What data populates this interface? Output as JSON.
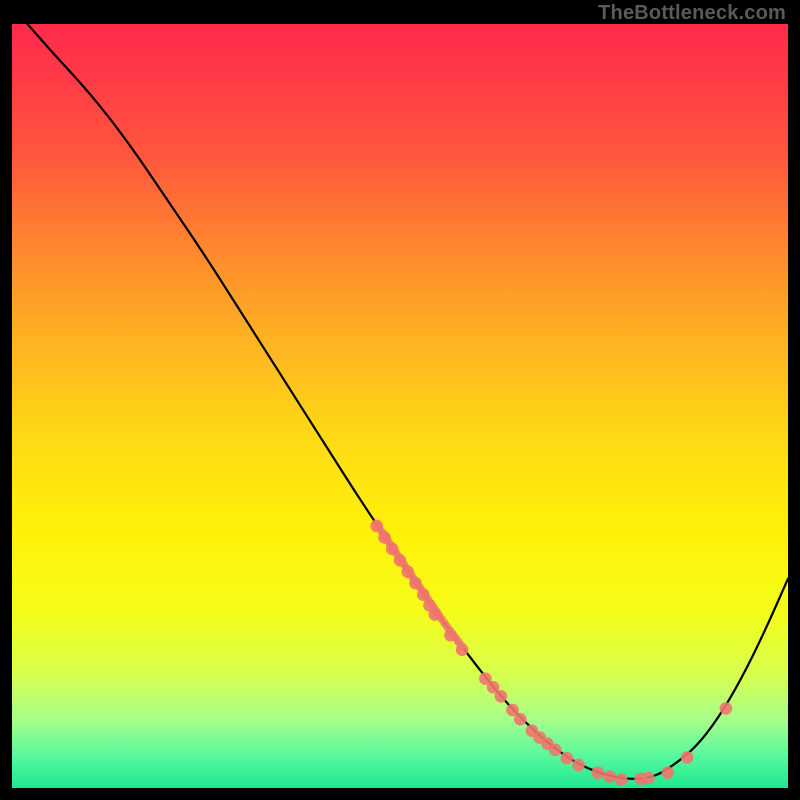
{
  "attribution": "TheBottleneck.com",
  "colors": {
    "gradient_top": "#ff2b4b",
    "gradient_bottom": "#1ee88f",
    "curve_stroke": "#000000",
    "point_fill": "#f0766d",
    "point_stroke": "#f0766d"
  },
  "chart_data": {
    "type": "line",
    "title": "",
    "xlabel": "",
    "ylabel": "",
    "xlim": [
      0,
      100
    ],
    "ylim": [
      0,
      100
    ],
    "grid": false,
    "curve": [
      {
        "x": 2,
        "y": 100
      },
      {
        "x": 5,
        "y": 96.5
      },
      {
        "x": 10,
        "y": 91
      },
      {
        "x": 15,
        "y": 84.5
      },
      {
        "x": 20,
        "y": 77
      },
      {
        "x": 25,
        "y": 69.5
      },
      {
        "x": 30,
        "y": 61.5
      },
      {
        "x": 35,
        "y": 53.5
      },
      {
        "x": 40,
        "y": 45.5
      },
      {
        "x": 45,
        "y": 37.5
      },
      {
        "x": 50,
        "y": 30
      },
      {
        "x": 53,
        "y": 25.6
      },
      {
        "x": 56,
        "y": 21.2
      },
      {
        "x": 60,
        "y": 15.8
      },
      {
        "x": 64,
        "y": 10.8
      },
      {
        "x": 68,
        "y": 6.8
      },
      {
        "x": 71,
        "y": 4.4
      },
      {
        "x": 74,
        "y": 2.6
      },
      {
        "x": 77,
        "y": 1.6
      },
      {
        "x": 79,
        "y": 1.2
      },
      {
        "x": 81,
        "y": 1.2
      },
      {
        "x": 83,
        "y": 1.6
      },
      {
        "x": 85,
        "y": 2.8
      },
      {
        "x": 88,
        "y": 5.2
      },
      {
        "x": 91,
        "y": 9.1
      },
      {
        "x": 94,
        "y": 14.3
      },
      {
        "x": 97,
        "y": 20.5
      },
      {
        "x": 100,
        "y": 27.4
      }
    ],
    "points_cluster_coarse": [
      {
        "x": 47,
        "y": 34.3
      },
      {
        "x": 48,
        "y": 32.8
      },
      {
        "x": 49,
        "y": 31.3
      },
      {
        "x": 50,
        "y": 29.8
      },
      {
        "x": 51,
        "y": 28.3
      },
      {
        "x": 52,
        "y": 26.8
      },
      {
        "x": 53,
        "y": 25.3
      },
      {
        "x": 53.8,
        "y": 23.9
      },
      {
        "x": 54.5,
        "y": 22.7
      },
      {
        "x": 56.5,
        "y": 20.0
      },
      {
        "x": 58,
        "y": 18.1
      },
      {
        "x": 61,
        "y": 14.3
      },
      {
        "x": 62,
        "y": 13.2
      },
      {
        "x": 63,
        "y": 12.0
      },
      {
        "x": 64.5,
        "y": 10.2
      },
      {
        "x": 65.5,
        "y": 9.0
      },
      {
        "x": 67,
        "y": 7.5
      },
      {
        "x": 68,
        "y": 6.6
      },
      {
        "x": 69,
        "y": 5.8
      },
      {
        "x": 70,
        "y": 5.0
      },
      {
        "x": 71.5,
        "y": 3.9
      },
      {
        "x": 73,
        "y": 3.0
      },
      {
        "x": 75.5,
        "y": 2.0
      },
      {
        "x": 77,
        "y": 1.5
      },
      {
        "x": 78.5,
        "y": 1.1
      },
      {
        "x": 81,
        "y": 1.2
      },
      {
        "x": 82,
        "y": 1.3
      },
      {
        "x": 84.5,
        "y": 2.0
      },
      {
        "x": 87,
        "y": 4.0
      },
      {
        "x": 92,
        "y": 10.4
      }
    ],
    "points_dense_segment": {
      "x_from": 47,
      "x_to": 58
    }
  }
}
